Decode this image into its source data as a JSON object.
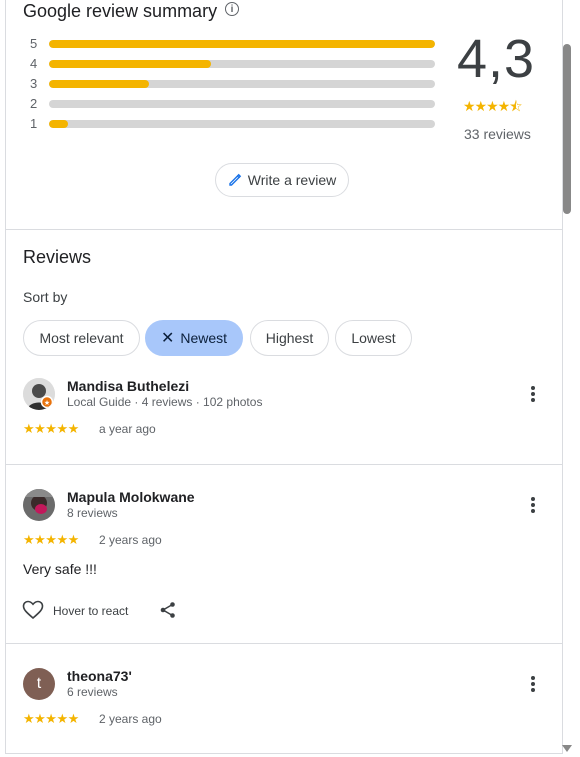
{
  "summary": {
    "title": "Google review summary",
    "info_glyph": "i",
    "bars": [
      {
        "label": "5",
        "fill_fraction": 1.0
      },
      {
        "label": "4",
        "fill_fraction": 0.42
      },
      {
        "label": "3",
        "fill_fraction": 0.26
      },
      {
        "label": "2",
        "fill_fraction": 0.0
      },
      {
        "label": "1",
        "fill_fraction": 0.05
      }
    ],
    "rating": "4,3",
    "rating_value": 4.3,
    "stars": "★★★★⯪",
    "reviews_count": "33 reviews",
    "write_review_label": "Write a review"
  },
  "reviews_section": {
    "heading": "Reviews",
    "sort_by_label": "Sort by",
    "chips": [
      {
        "label": "Most relevant",
        "selected": false
      },
      {
        "label": "Newest",
        "selected": true,
        "clear_glyph": "✕"
      },
      {
        "label": "Highest",
        "selected": false
      },
      {
        "label": "Lowest",
        "selected": false
      }
    ]
  },
  "reviews": [
    {
      "author": "Mandisa Buthelezi",
      "meta": "Local Guide · 4 reviews · 102 photos",
      "stars": "★★★★★",
      "rating": 5,
      "time": "a year ago"
    },
    {
      "author": "Mapula Molokwane",
      "meta": "8 reviews",
      "stars": "★★★★★",
      "rating": 5,
      "time": "2 years ago",
      "text": "Very safe !!!",
      "react_label": "Hover to react"
    },
    {
      "author": "theona73'",
      "avatar_letter": "t",
      "meta": "6 reviews",
      "stars": "★★★★★",
      "rating": 5,
      "time": "2 years ago"
    }
  ],
  "colors": {
    "star": "#f4b400",
    "selected_chip": "#a8c7fa",
    "avatar_t": "#7f5f54"
  }
}
